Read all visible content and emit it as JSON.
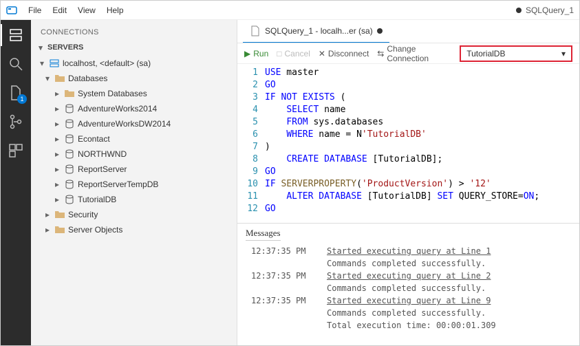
{
  "titlebar": {
    "menus": [
      "File",
      "Edit",
      "View",
      "Help"
    ],
    "title_right": "SQLQuery_1"
  },
  "activity_bar": {
    "items": [
      {
        "name": "servers-icon",
        "active": true
      },
      {
        "name": "search-icon",
        "active": false
      },
      {
        "name": "files-icon",
        "active": false,
        "badge": "1"
      },
      {
        "name": "source-control-icon",
        "active": false
      },
      {
        "name": "extensions-icon",
        "active": false
      }
    ]
  },
  "sidebar": {
    "title": "CONNECTIONS",
    "section": "SERVERS",
    "server_label": "localhost, <default> (sa)",
    "databases_label": "Databases",
    "databases": [
      {
        "label": "System Databases",
        "type": "folder"
      },
      {
        "label": "AdventureWorks2014",
        "type": "db"
      },
      {
        "label": "AdventureWorksDW2014",
        "type": "db"
      },
      {
        "label": "Econtact",
        "type": "db"
      },
      {
        "label": "NORTHWND",
        "type": "db"
      },
      {
        "label": "ReportServer",
        "type": "db"
      },
      {
        "label": "ReportServerTempDB",
        "type": "db"
      },
      {
        "label": "TutorialDB",
        "type": "db"
      }
    ],
    "security_label": "Security",
    "server_objects_label": "Server Objects"
  },
  "tab": {
    "label": "SQLQuery_1 - localh...er (sa)"
  },
  "toolbar": {
    "run": "Run",
    "cancel": "Cancel",
    "disconnect": "Disconnect",
    "change_conn": "Change Connection",
    "db_selected": "TutorialDB"
  },
  "code": {
    "lines": [
      [
        [
          "kw",
          "USE"
        ],
        [
          "plain",
          " master"
        ]
      ],
      [
        [
          "kw",
          "GO"
        ]
      ],
      [
        [
          "kw",
          "IF"
        ],
        [
          "plain",
          " "
        ],
        [
          "kw",
          "NOT"
        ],
        [
          "plain",
          " "
        ],
        [
          "kw",
          "EXISTS"
        ],
        [
          "plain",
          " ("
        ]
      ],
      [
        [
          "plain",
          "    "
        ],
        [
          "kw",
          "SELECT"
        ],
        [
          "plain",
          " name"
        ]
      ],
      [
        [
          "plain",
          "    "
        ],
        [
          "kw",
          "FROM"
        ],
        [
          "plain",
          " sys.databases"
        ]
      ],
      [
        [
          "plain",
          "    "
        ],
        [
          "kw",
          "WHERE"
        ],
        [
          "plain",
          " name = N"
        ],
        [
          "str",
          "'TutorialDB'"
        ]
      ],
      [
        [
          "plain",
          ")"
        ]
      ],
      [
        [
          "plain",
          "    "
        ],
        [
          "kw",
          "CREATE"
        ],
        [
          "plain",
          " "
        ],
        [
          "kw",
          "DATABASE"
        ],
        [
          "plain",
          " [TutorialDB];"
        ]
      ],
      [
        [
          "kw",
          "GO"
        ]
      ],
      [
        [
          "kw",
          "IF"
        ],
        [
          "plain",
          " "
        ],
        [
          "fn",
          "SERVERPROPERTY"
        ],
        [
          "plain",
          "("
        ],
        [
          "str",
          "'ProductVersion'"
        ],
        [
          "plain",
          ") > "
        ],
        [
          "str",
          "'12'"
        ]
      ],
      [
        [
          "plain",
          "    "
        ],
        [
          "kw",
          "ALTER"
        ],
        [
          "plain",
          " "
        ],
        [
          "kw",
          "DATABASE"
        ],
        [
          "plain",
          " [TutorialDB] "
        ],
        [
          "kw",
          "SET"
        ],
        [
          "plain",
          " QUERY_STORE="
        ],
        [
          "kw",
          "ON"
        ],
        [
          "plain",
          ";"
        ]
      ],
      [
        [
          "kw",
          "GO"
        ]
      ]
    ]
  },
  "messages": {
    "header": "Messages",
    "rows": [
      {
        "time": "12:37:35 PM",
        "text": "Started executing query at Line 1",
        "underline": true
      },
      {
        "time": "",
        "text": "Commands completed successfully."
      },
      {
        "time": "12:37:35 PM",
        "text": "Started executing query at Line 2",
        "underline": true
      },
      {
        "time": "",
        "text": "Commands completed successfully."
      },
      {
        "time": "12:37:35 PM",
        "text": "Started executing query at Line 9",
        "underline": true
      },
      {
        "time": "",
        "text": "Commands completed successfully."
      },
      {
        "time": "",
        "text": "Total execution time: 00:00:01.309"
      }
    ]
  }
}
